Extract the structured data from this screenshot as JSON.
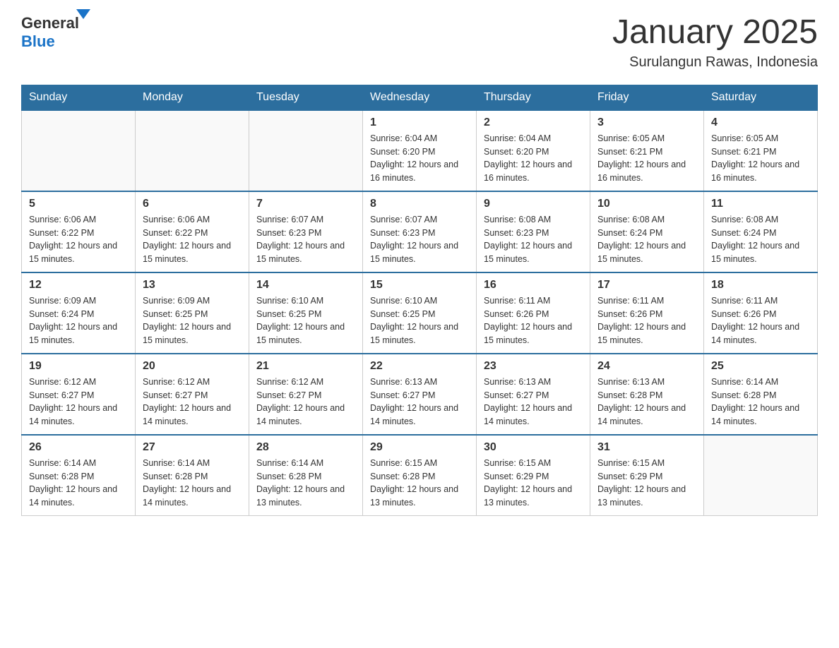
{
  "header": {
    "logo": {
      "general": "General",
      "blue": "Blue"
    },
    "title": "January 2025",
    "subtitle": "Surulangun Rawas, Indonesia"
  },
  "weekdays": [
    "Sunday",
    "Monday",
    "Tuesday",
    "Wednesday",
    "Thursday",
    "Friday",
    "Saturday"
  ],
  "weeks": [
    {
      "cells": [
        {
          "empty": true
        },
        {
          "empty": true
        },
        {
          "empty": true
        },
        {
          "day": 1,
          "sunrise": "6:04 AM",
          "sunset": "6:20 PM",
          "daylight": "12 hours and 16 minutes."
        },
        {
          "day": 2,
          "sunrise": "6:04 AM",
          "sunset": "6:20 PM",
          "daylight": "12 hours and 16 minutes."
        },
        {
          "day": 3,
          "sunrise": "6:05 AM",
          "sunset": "6:21 PM",
          "daylight": "12 hours and 16 minutes."
        },
        {
          "day": 4,
          "sunrise": "6:05 AM",
          "sunset": "6:21 PM",
          "daylight": "12 hours and 16 minutes."
        }
      ]
    },
    {
      "cells": [
        {
          "day": 5,
          "sunrise": "6:06 AM",
          "sunset": "6:22 PM",
          "daylight": "12 hours and 15 minutes."
        },
        {
          "day": 6,
          "sunrise": "6:06 AM",
          "sunset": "6:22 PM",
          "daylight": "12 hours and 15 minutes."
        },
        {
          "day": 7,
          "sunrise": "6:07 AM",
          "sunset": "6:23 PM",
          "daylight": "12 hours and 15 minutes."
        },
        {
          "day": 8,
          "sunrise": "6:07 AM",
          "sunset": "6:23 PM",
          "daylight": "12 hours and 15 minutes."
        },
        {
          "day": 9,
          "sunrise": "6:08 AM",
          "sunset": "6:23 PM",
          "daylight": "12 hours and 15 minutes."
        },
        {
          "day": 10,
          "sunrise": "6:08 AM",
          "sunset": "6:24 PM",
          "daylight": "12 hours and 15 minutes."
        },
        {
          "day": 11,
          "sunrise": "6:08 AM",
          "sunset": "6:24 PM",
          "daylight": "12 hours and 15 minutes."
        }
      ]
    },
    {
      "cells": [
        {
          "day": 12,
          "sunrise": "6:09 AM",
          "sunset": "6:24 PM",
          "daylight": "12 hours and 15 minutes."
        },
        {
          "day": 13,
          "sunrise": "6:09 AM",
          "sunset": "6:25 PM",
          "daylight": "12 hours and 15 minutes."
        },
        {
          "day": 14,
          "sunrise": "6:10 AM",
          "sunset": "6:25 PM",
          "daylight": "12 hours and 15 minutes."
        },
        {
          "day": 15,
          "sunrise": "6:10 AM",
          "sunset": "6:25 PM",
          "daylight": "12 hours and 15 minutes."
        },
        {
          "day": 16,
          "sunrise": "6:11 AM",
          "sunset": "6:26 PM",
          "daylight": "12 hours and 15 minutes."
        },
        {
          "day": 17,
          "sunrise": "6:11 AM",
          "sunset": "6:26 PM",
          "daylight": "12 hours and 15 minutes."
        },
        {
          "day": 18,
          "sunrise": "6:11 AM",
          "sunset": "6:26 PM",
          "daylight": "12 hours and 14 minutes."
        }
      ]
    },
    {
      "cells": [
        {
          "day": 19,
          "sunrise": "6:12 AM",
          "sunset": "6:27 PM",
          "daylight": "12 hours and 14 minutes."
        },
        {
          "day": 20,
          "sunrise": "6:12 AM",
          "sunset": "6:27 PM",
          "daylight": "12 hours and 14 minutes."
        },
        {
          "day": 21,
          "sunrise": "6:12 AM",
          "sunset": "6:27 PM",
          "daylight": "12 hours and 14 minutes."
        },
        {
          "day": 22,
          "sunrise": "6:13 AM",
          "sunset": "6:27 PM",
          "daylight": "12 hours and 14 minutes."
        },
        {
          "day": 23,
          "sunrise": "6:13 AM",
          "sunset": "6:27 PM",
          "daylight": "12 hours and 14 minutes."
        },
        {
          "day": 24,
          "sunrise": "6:13 AM",
          "sunset": "6:28 PM",
          "daylight": "12 hours and 14 minutes."
        },
        {
          "day": 25,
          "sunrise": "6:14 AM",
          "sunset": "6:28 PM",
          "daylight": "12 hours and 14 minutes."
        }
      ]
    },
    {
      "cells": [
        {
          "day": 26,
          "sunrise": "6:14 AM",
          "sunset": "6:28 PM",
          "daylight": "12 hours and 14 minutes."
        },
        {
          "day": 27,
          "sunrise": "6:14 AM",
          "sunset": "6:28 PM",
          "daylight": "12 hours and 14 minutes."
        },
        {
          "day": 28,
          "sunrise": "6:14 AM",
          "sunset": "6:28 PM",
          "daylight": "12 hours and 13 minutes."
        },
        {
          "day": 29,
          "sunrise": "6:15 AM",
          "sunset": "6:28 PM",
          "daylight": "12 hours and 13 minutes."
        },
        {
          "day": 30,
          "sunrise": "6:15 AM",
          "sunset": "6:29 PM",
          "daylight": "12 hours and 13 minutes."
        },
        {
          "day": 31,
          "sunrise": "6:15 AM",
          "sunset": "6:29 PM",
          "daylight": "12 hours and 13 minutes."
        },
        {
          "empty": true
        }
      ]
    }
  ],
  "labels": {
    "sunrise": "Sunrise:",
    "sunset": "Sunset:",
    "daylight": "Daylight:"
  }
}
